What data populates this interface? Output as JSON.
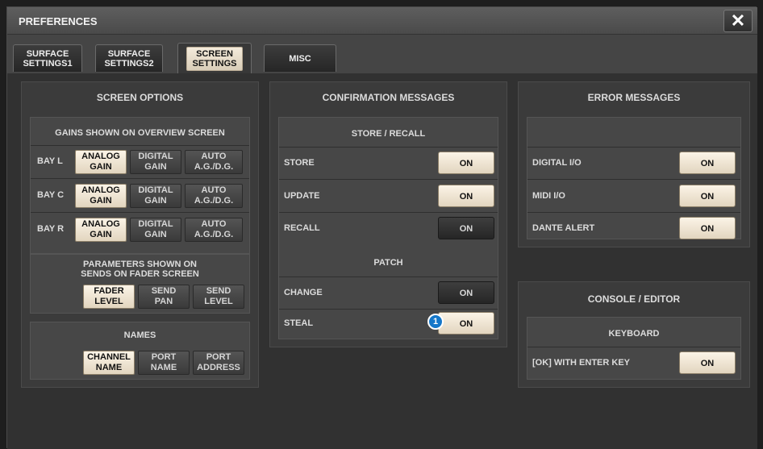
{
  "window": {
    "title": "PREFERENCES",
    "close_glyph": "✕"
  },
  "tabs": [
    {
      "label": "SURFACE\nSETTINGS1",
      "active": false
    },
    {
      "label": "SURFACE\nSETTINGS2",
      "active": false
    },
    {
      "label": "SCREEN\nSETTINGS",
      "active": true
    },
    {
      "label": "MISC",
      "active": false
    }
  ],
  "screen_options": {
    "title": "SCREEN OPTIONS",
    "gains": {
      "title": "GAINS SHOWN ON OVERVIEW SCREEN",
      "rows": [
        {
          "label": "BAY L",
          "options": [
            "ANALOG\nGAIN",
            "DIGITAL\nGAIN",
            "AUTO\nA.G./D.G."
          ],
          "selected": 0
        },
        {
          "label": "BAY C",
          "options": [
            "ANALOG\nGAIN",
            "DIGITAL\nGAIN",
            "AUTO\nA.G./D.G."
          ],
          "selected": 0
        },
        {
          "label": "BAY R",
          "options": [
            "ANALOG\nGAIN",
            "DIGITAL\nGAIN",
            "AUTO\nA.G./D.G."
          ],
          "selected": 0
        }
      ]
    },
    "sends": {
      "title": "PARAMETERS SHOWN ON\nSENDS ON FADER SCREEN",
      "options": [
        "FADER\nLEVEL",
        "SEND\nPAN",
        "SEND\nLEVEL"
      ],
      "selected": 0
    },
    "names": {
      "title": "NAMES",
      "options": [
        "CHANNEL\nNAME",
        "PORT\nNAME",
        "PORT\nADDRESS"
      ],
      "selected": 0
    }
  },
  "confirmation": {
    "title": "CONFIRMATION MESSAGES",
    "store_recall": {
      "title": "STORE / RECALL",
      "rows": [
        {
          "label": "STORE",
          "value": "ON",
          "lit": true
        },
        {
          "label": "UPDATE",
          "value": "ON",
          "lit": true
        },
        {
          "label": "RECALL",
          "value": "ON",
          "lit": false
        }
      ]
    },
    "patch": {
      "title": "PATCH",
      "rows": [
        {
          "label": "CHANGE",
          "value": "ON",
          "lit": false
        },
        {
          "label": "STEAL",
          "value": "ON",
          "lit": true
        }
      ]
    },
    "callout": "1"
  },
  "errors": {
    "title": "ERROR MESSAGES",
    "rows": [
      {
        "label": "DIGITAL I/O",
        "value": "ON",
        "lit": true
      },
      {
        "label": "MIDI I/O",
        "value": "ON",
        "lit": true
      },
      {
        "label": "DANTE ALERT",
        "value": "ON",
        "lit": true
      }
    ]
  },
  "console_editor": {
    "title": "CONSOLE / EDITOR",
    "keyboard": {
      "title": "KEYBOARD",
      "rows": [
        {
          "label": "[OK] WITH ENTER KEY",
          "value": "ON",
          "lit": true
        }
      ]
    }
  },
  "colors": {
    "lit_button": "#f3eadb",
    "dark_button": "#2e2e2e",
    "callout": "#1577c9"
  }
}
